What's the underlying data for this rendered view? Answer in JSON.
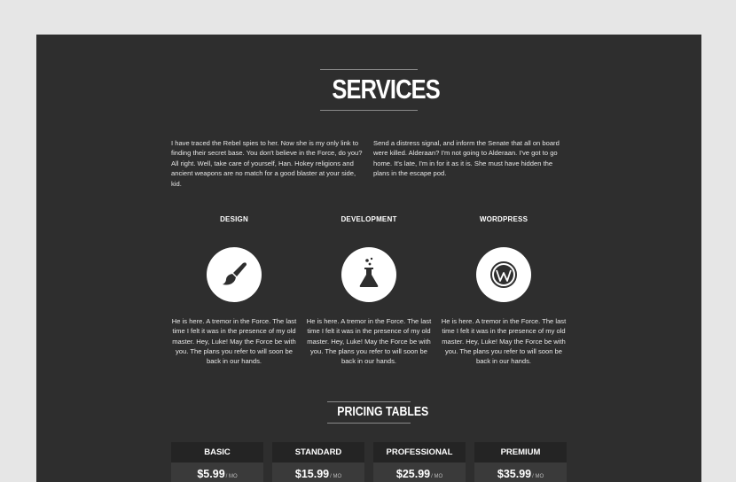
{
  "services": {
    "title": "SERVICES",
    "intro_left": "I have traced the Rebel spies to her. Now she is my only link to finding their secret base. You don't believe in the Force, do you? All right. Well, take care of yourself, Han. Hokey religions and ancient weapons are no match for a good blaster at your side, kid.",
    "intro_right": "Send a distress signal, and inform the Senate that all on board were killed. Alderaan? I'm not going to Alderaan. I've got to go home. It's late, I'm in for it as it is. She must have hidden the plans in the escape pod.",
    "items": [
      {
        "heading": "DESIGN",
        "icon": "paintbrush-icon",
        "description": "He is here. A tremor in the Force. The last time I felt it was in the presence of my old master. Hey, Luke! May the Force be with you. The plans you refer to will soon be back in our hands."
      },
      {
        "heading": "DEVELOPMENT",
        "icon": "flask-icon",
        "description": "He is here. A tremor in the Force. The last time I felt it was in the presence of my old master. Hey, Luke! May the Force be with you. The plans you refer to will soon be back in our hands."
      },
      {
        "heading": "WORDPRESS",
        "icon": "wordpress-icon",
        "description": "He is here. A tremor in the Force. The last time I felt it was in the presence of my old master. Hey, Luke! May the Force be with you. The plans you refer to will soon be back in our hands."
      }
    ]
  },
  "pricing": {
    "title": "PRICING TABLES",
    "plans": [
      {
        "name": "BASIC",
        "price": "$5.99",
        "per": "/ MO"
      },
      {
        "name": "STANDARD",
        "price": "$15.99",
        "per": "/ MO"
      },
      {
        "name": "PROFESSIONAL",
        "price": "$25.99",
        "per": "/ MO"
      },
      {
        "name": "PREMIUM",
        "price": "$35.99",
        "per": "/ MO"
      }
    ]
  },
  "colors": {
    "page_background": "#e6e6e6",
    "panel_background": "#2e2e2e",
    "plan_header": "#242424",
    "plan_body": "#3a3a3a",
    "text": "#ffffff"
  }
}
